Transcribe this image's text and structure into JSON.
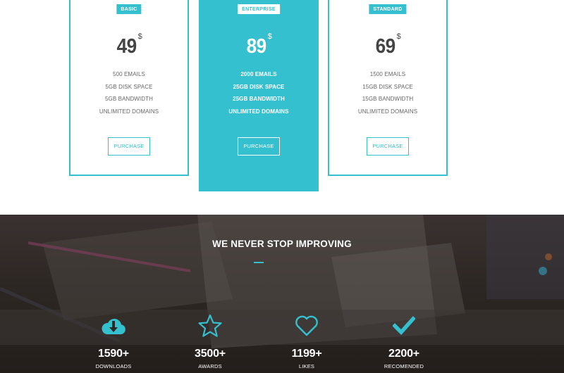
{
  "pricing": {
    "plans": [
      {
        "badge": "BASIC",
        "price": "49",
        "currency": "$",
        "features": [
          "500 EMAILS",
          "5GB DISK SPACE",
          "5GB BANDWIDTH",
          "UNLIMITED DOMAINS"
        ],
        "button": "PURCHASE"
      },
      {
        "badge": "ENTERPRISE",
        "price": "89",
        "currency": "$",
        "features": [
          "2000 EMAILS",
          "25GB DISK SPACE",
          "25GB BANDWIDTH",
          "UNLIMITED DOMAINS"
        ],
        "button": "PURCHASE"
      },
      {
        "badge": "STANDARD",
        "price": "69",
        "currency": "$",
        "features": [
          "1500 EMAILS",
          "15GB DISK SPACE",
          "15GB BANDWIDTH",
          "UNLIMITED DOMAINS"
        ],
        "button": "PURCHASE"
      }
    ]
  },
  "stats": {
    "title": "WE NEVER STOP IMPROVING",
    "items": [
      {
        "icon": "cloud-download-icon",
        "value": "1590+",
        "label": "DOWNLOADS"
      },
      {
        "icon": "star-icon",
        "value": "3500+",
        "label": "AWARDS"
      },
      {
        "icon": "heart-icon",
        "value": "1199+",
        "label": "LIKES"
      },
      {
        "icon": "check-icon",
        "value": "2200+",
        "label": "RECOMENDED"
      }
    ]
  },
  "colors": {
    "accent": "#35c0d0",
    "dark_bg": "#2d2724",
    "text_muted": "#666666"
  }
}
